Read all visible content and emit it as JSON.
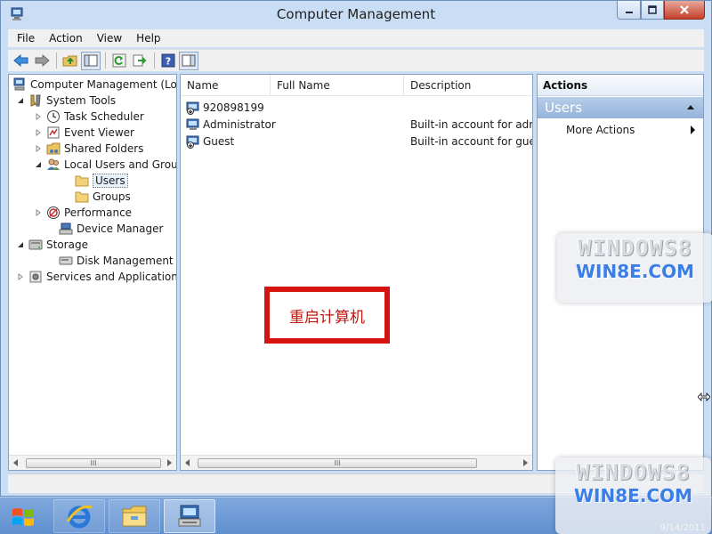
{
  "window": {
    "title": "Computer Management"
  },
  "menu": [
    "File",
    "Action",
    "View",
    "Help"
  ],
  "toolbar": {
    "icons": [
      "back-arrow-icon",
      "forward-arrow-icon",
      "up-folder-icon",
      "show-hide-tree-icon",
      "refresh-icon",
      "export-list-icon",
      "help-icon",
      "show-hide-action-pane-icon"
    ]
  },
  "tree": {
    "items": [
      {
        "label": "Computer Management (Local",
        "icon": "computer-management-icon",
        "twisty": "none"
      },
      {
        "label": "System Tools",
        "icon": "system-tools-icon",
        "twisty": "expanded"
      },
      {
        "label": "Task Scheduler",
        "icon": "clock-icon",
        "twisty": "collapsed"
      },
      {
        "label": "Event Viewer",
        "icon": "event-viewer-icon",
        "twisty": "collapsed"
      },
      {
        "label": "Shared Folders",
        "icon": "shared-folder-icon",
        "twisty": "collapsed"
      },
      {
        "label": "Local Users and Groups",
        "icon": "users-groups-icon",
        "twisty": "expanded"
      },
      {
        "label": "Users",
        "icon": "folder-icon",
        "twisty": "none",
        "selected": true
      },
      {
        "label": "Groups",
        "icon": "folder-icon",
        "twisty": "none"
      },
      {
        "label": "Performance",
        "icon": "performance-icon",
        "twisty": "collapsed"
      },
      {
        "label": "Device Manager",
        "icon": "device-manager-icon",
        "twisty": "none"
      },
      {
        "label": "Storage",
        "icon": "storage-icon",
        "twisty": "expanded"
      },
      {
        "label": "Disk Management",
        "icon": "disk-icon",
        "twisty": "none"
      },
      {
        "label": "Services and Applications",
        "icon": "services-icon",
        "twisty": "collapsed"
      }
    ]
  },
  "list": {
    "columns": [
      "Name",
      "Full Name",
      "Description"
    ],
    "rows": [
      {
        "name": "920898199",
        "full_name": "",
        "description": ""
      },
      {
        "name": "Administrator",
        "full_name": "",
        "description": "Built-in account for administering the computer/domain"
      },
      {
        "name": "Guest",
        "full_name": "",
        "description": "Built-in account for guest access to the computer/domain"
      }
    ],
    "overlay_text": "重启计算机"
  },
  "actions": {
    "header": "Actions",
    "section": "Users",
    "items": [
      "More Actions"
    ]
  },
  "watermark": {
    "line1": "WINDOWS8",
    "line2": "WIN8E.COM",
    "date": "9/14/2011"
  },
  "taskbar": {
    "apps": [
      "start-button-icon",
      "internet-explorer-icon",
      "file-explorer-icon",
      "computer-management-icon"
    ]
  },
  "colors": {
    "accent": "#94b3db",
    "overlay_red": "#d6140f",
    "watermark_blue": "#3a7ee8"
  }
}
